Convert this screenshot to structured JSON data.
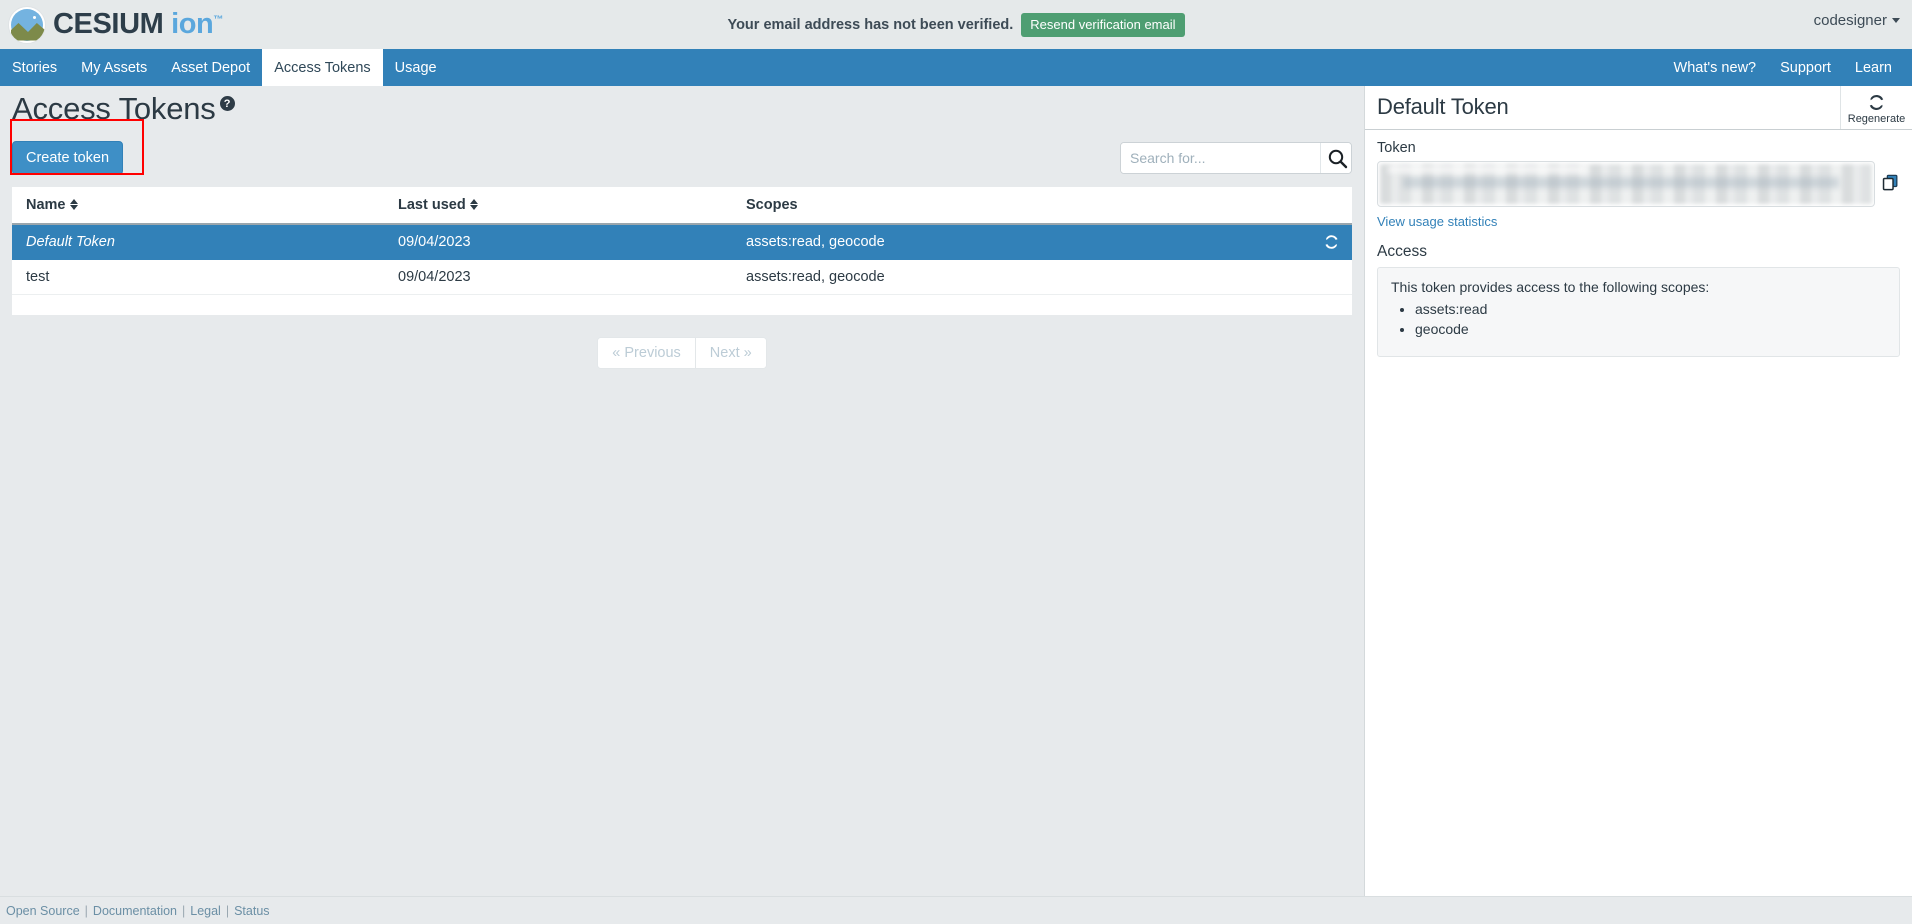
{
  "brand": {
    "name_main": "CESIUM",
    "name_sub": "ion",
    "trademark": "™"
  },
  "topbar": {
    "verify_message": "Your email address has not been verified.",
    "resend_label": "Resend verification email",
    "username": "codesigner"
  },
  "nav": {
    "left_items": [
      {
        "label": "Stories",
        "active": false
      },
      {
        "label": "My Assets",
        "active": false
      },
      {
        "label": "Asset Depot",
        "active": false
      },
      {
        "label": "Access Tokens",
        "active": true
      },
      {
        "label": "Usage",
        "active": false
      }
    ],
    "right_items": [
      {
        "label": "What's new?"
      },
      {
        "label": "Support"
      },
      {
        "label": "Learn"
      }
    ]
  },
  "page": {
    "title": "Access Tokens",
    "help_glyph": "?",
    "create_label": "Create token"
  },
  "search": {
    "placeholder": "Search for...",
    "value": ""
  },
  "table": {
    "columns": [
      {
        "label": "Name",
        "sortable": true
      },
      {
        "label": "Last used",
        "sortable": true
      },
      {
        "label": "Scopes",
        "sortable": false
      }
    ],
    "rows": [
      {
        "name": "Default Token",
        "last_used": "09/04/2023",
        "scopes": "assets:read, geocode",
        "selected": true,
        "has_refresh_icon": true
      },
      {
        "name": "test",
        "last_used": "09/04/2023",
        "scopes": "assets:read, geocode",
        "selected": false,
        "has_refresh_icon": false
      }
    ]
  },
  "pagination": {
    "previous_label": "« Previous",
    "next_label": "Next »"
  },
  "detail_panel": {
    "title": "Default Token",
    "regenerate_label": "Regenerate",
    "token_label": "Token",
    "token_value": "",
    "usage_link_label": "View usage statistics",
    "access_label": "Access",
    "access_description": "This token provides access to the following scopes:",
    "scopes": [
      "assets:read",
      "geocode"
    ]
  },
  "footer": {
    "links": [
      "Open Source",
      "Documentation",
      "Legal",
      "Status"
    ],
    "separator": "|"
  },
  "colors": {
    "nav_blue": "#3281b8",
    "accent_green": "#4e9e72",
    "annotation_red": "#ff0000",
    "page_bg": "#e7eaec"
  }
}
